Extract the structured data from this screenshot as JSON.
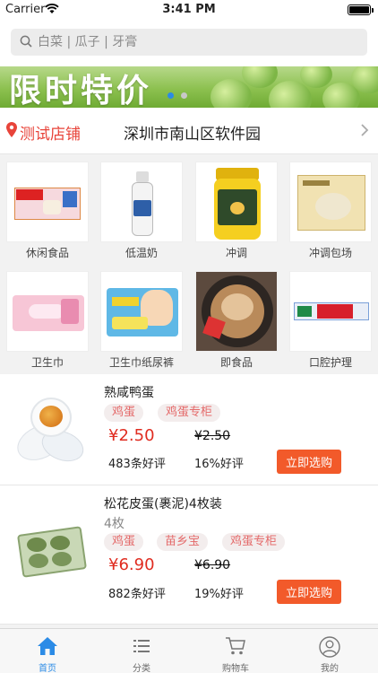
{
  "status_bar": {
    "carrier": "Carrier",
    "time": "3:41 PM"
  },
  "search": {
    "placeholder": "白菜 | 瓜子 | 牙膏"
  },
  "banner": {
    "text": "限时特价",
    "active_dot": 0,
    "dot_count": 2
  },
  "store": {
    "name": "测试店铺",
    "address": "深圳市南山区软件园"
  },
  "categories": [
    {
      "label": "休闲食品",
      "icon": "snack-box-image"
    },
    {
      "label": "低温奶",
      "icon": "milk-bottle-image"
    },
    {
      "label": "冲调",
      "icon": "honey-jar-image"
    },
    {
      "label": "冲调包场",
      "icon": "drink-pack-image"
    },
    {
      "label": "卫生巾",
      "icon": "pad-pack-image"
    },
    {
      "label": "卫生巾纸尿裤",
      "icon": "diaper-pack-image"
    },
    {
      "label": "即食品",
      "icon": "instant-noodle-image"
    },
    {
      "label": "口腔护理",
      "icon": "toothpaste-image"
    }
  ],
  "products": [
    {
      "title": "熟咸鸭蛋",
      "subtitle": "",
      "tags": [
        "鸡蛋",
        "鸡蛋专柜"
      ],
      "price": "¥2.50",
      "old_price": "¥2.50",
      "reviews": "483条好评",
      "rate": "16%好评",
      "button": "立即选购"
    },
    {
      "title": "松花皮蛋(裹泥)4枚装",
      "subtitle": "4枚",
      "tags": [
        "鸡蛋",
        "苗乡宝",
        "鸡蛋专柜"
      ],
      "price": "¥6.90",
      "old_price": "¥6.90",
      "reviews": "882条好评",
      "rate": "19%好评",
      "button": "立即选购"
    }
  ],
  "tabs": [
    {
      "label": "首页",
      "icon": "home-icon",
      "active": true
    },
    {
      "label": "分类",
      "icon": "list-icon",
      "active": false
    },
    {
      "label": "购物车",
      "icon": "cart-icon",
      "active": false
    },
    {
      "label": "我的",
      "icon": "user-icon",
      "active": false
    }
  ],
  "colors": {
    "accent": "#2b8be6",
    "price": "#e02c20",
    "button": "#f25a2a",
    "store": "#e8443a"
  }
}
